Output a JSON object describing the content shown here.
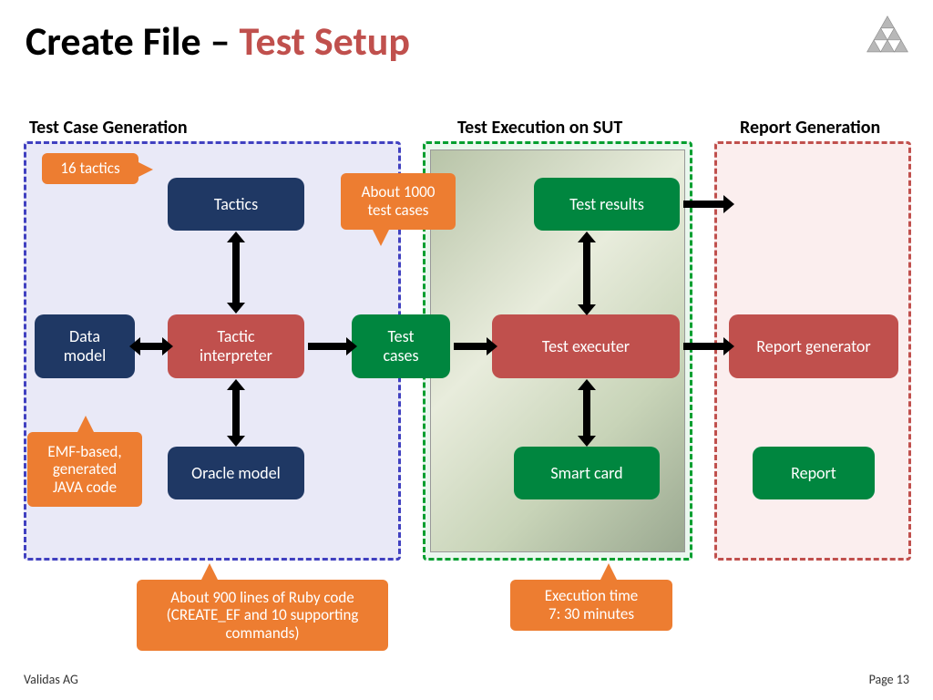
{
  "title": {
    "part1": "Create File – ",
    "part2": "Test Setup"
  },
  "sections": {
    "generation": "Test Case Generation",
    "execution": "Test Execution on SUT",
    "report": "Report Generation"
  },
  "nodes": {
    "tactics": "Tactics",
    "data_model": "Data\nmodel",
    "interpreter": "Tactic\ninterpreter",
    "oracle": "Oracle model",
    "test_cases": "Test\ncases",
    "test_results": "Test results",
    "test_executer": "Test executer",
    "smart_card": "Smart card",
    "report_gen": "Report generator",
    "report": "Report"
  },
  "callouts": {
    "sixteen": "16 tactics",
    "about1000": "About 1000\ntest cases",
    "emf": "EMF-based,\ngenerated\nJAVA code",
    "ruby": "About 900 lines of Ruby code\n(CREATE_EF and 10 supporting\ncommands)",
    "exec_time": "Execution time\n7: 30 minutes"
  },
  "footer": {
    "left": "Validas AG",
    "right": "Page 13"
  }
}
